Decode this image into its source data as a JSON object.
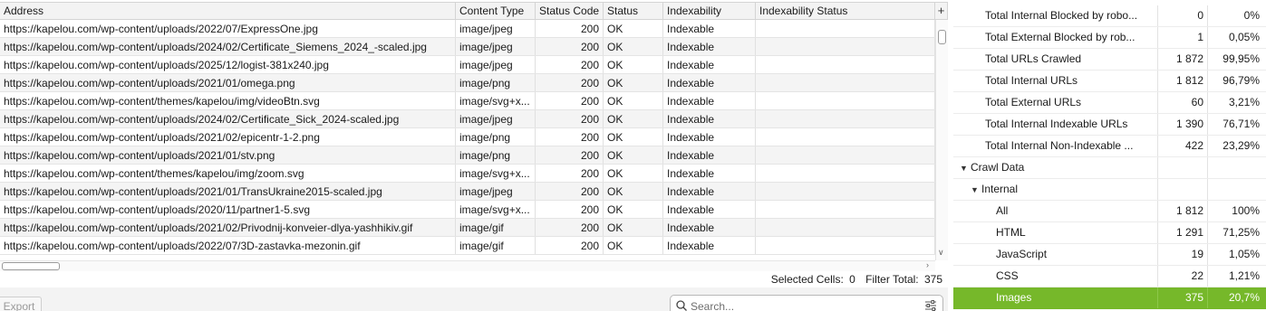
{
  "table": {
    "columns": [
      "Address",
      "Content Type",
      "Status Code",
      "Status",
      "Indexability",
      "Indexability Status"
    ],
    "rows": [
      {
        "address": "https://kapelou.com/wp-content/uploads/2022/07/ExpressOne.jpg",
        "content_type": "image/jpeg",
        "status_code": "200",
        "status": "OK",
        "indexability": "Indexable",
        "indexability_status": ""
      },
      {
        "address": "https://kapelou.com/wp-content/uploads/2024/02/Certificate_Siemens_2024_-scaled.jpg",
        "content_type": "image/jpeg",
        "status_code": "200",
        "status": "OK",
        "indexability": "Indexable",
        "indexability_status": ""
      },
      {
        "address": "https://kapelou.com/wp-content/uploads/2025/12/logist-381x240.jpg",
        "content_type": "image/jpeg",
        "status_code": "200",
        "status": "OK",
        "indexability": "Indexable",
        "indexability_status": ""
      },
      {
        "address": "https://kapelou.com/wp-content/uploads/2021/01/omega.png",
        "content_type": "image/png",
        "status_code": "200",
        "status": "OK",
        "indexability": "Indexable",
        "indexability_status": ""
      },
      {
        "address": "https://kapelou.com/wp-content/themes/kapelou/img/videoBtn.svg",
        "content_type": "image/svg+x...",
        "status_code": "200",
        "status": "OK",
        "indexability": "Indexable",
        "indexability_status": ""
      },
      {
        "address": "https://kapelou.com/wp-content/uploads/2024/02/Certificate_Sick_2024-scaled.jpg",
        "content_type": "image/jpeg",
        "status_code": "200",
        "status": "OK",
        "indexability": "Indexable",
        "indexability_status": ""
      },
      {
        "address": "https://kapelou.com/wp-content/uploads/2021/02/epicentr-1-2.png",
        "content_type": "image/png",
        "status_code": "200",
        "status": "OK",
        "indexability": "Indexable",
        "indexability_status": ""
      },
      {
        "address": "https://kapelou.com/wp-content/uploads/2021/01/stv.png",
        "content_type": "image/png",
        "status_code": "200",
        "status": "OK",
        "indexability": "Indexable",
        "indexability_status": ""
      },
      {
        "address": "https://kapelou.com/wp-content/themes/kapelou/img/zoom.svg",
        "content_type": "image/svg+x...",
        "status_code": "200",
        "status": "OK",
        "indexability": "Indexable",
        "indexability_status": ""
      },
      {
        "address": "https://kapelou.com/wp-content/uploads/2021/01/TransUkraine2015-scaled.jpg",
        "content_type": "image/jpeg",
        "status_code": "200",
        "status": "OK",
        "indexability": "Indexable",
        "indexability_status": ""
      },
      {
        "address": "https://kapelou.com/wp-content/uploads/2020/11/partner1-5.svg",
        "content_type": "image/svg+x...",
        "status_code": "200",
        "status": "OK",
        "indexability": "Indexable",
        "indexability_status": ""
      },
      {
        "address": "https://kapelou.com/wp-content/uploads/2021/02/Privodnij-konveier-dlya-yashhikiv.gif",
        "content_type": "image/gif",
        "status_code": "200",
        "status": "OK",
        "indexability": "Indexable",
        "indexability_status": ""
      },
      {
        "address": "https://kapelou.com/wp-content/uploads/2022/07/3D-zastavka-mezonin.gif",
        "content_type": "image/gif",
        "status_code": "200",
        "status": "OK",
        "indexability": "Indexable",
        "indexability_status": ""
      }
    ],
    "add_column_label": "+"
  },
  "status_bar": {
    "selected_label": "Selected Cells:",
    "selected_value": "0",
    "filter_label": "Filter Total:",
    "filter_value": "375"
  },
  "footer": {
    "export_label": "Export",
    "search_placeholder": "Search..."
  },
  "overview": {
    "rows": [
      {
        "label": "Total Internal Blocked by robo...",
        "count": "0",
        "pct": "0%",
        "depth": 0,
        "expander": "",
        "selected": false
      },
      {
        "label": "Total External Blocked by rob...",
        "count": "1",
        "pct": "0,05%",
        "depth": 0,
        "expander": "",
        "selected": false
      },
      {
        "label": "Total URLs Crawled",
        "count": "1 872",
        "pct": "99,95%",
        "depth": 0,
        "expander": "",
        "selected": false
      },
      {
        "label": "Total Internal URLs",
        "count": "1 812",
        "pct": "96,79%",
        "depth": 0,
        "expander": "",
        "selected": false
      },
      {
        "label": "Total External URLs",
        "count": "60",
        "pct": "3,21%",
        "depth": 0,
        "expander": "",
        "selected": false
      },
      {
        "label": "Total Internal Indexable URLs",
        "count": "1 390",
        "pct": "76,71%",
        "depth": 0,
        "expander": "",
        "selected": false
      },
      {
        "label": "Total Internal Non-Indexable ...",
        "count": "422",
        "pct": "23,29%",
        "depth": 0,
        "expander": "",
        "selected": false
      },
      {
        "label": "Crawl Data",
        "count": "",
        "pct": "",
        "depth": 0,
        "expander": "expanded",
        "selected": false
      },
      {
        "label": "Internal",
        "count": "",
        "pct": "",
        "depth": 1,
        "expander": "expanded",
        "selected": false
      },
      {
        "label": "All",
        "count": "1 812",
        "pct": "100%",
        "depth": 2,
        "expander": "",
        "selected": false
      },
      {
        "label": "HTML",
        "count": "1 291",
        "pct": "71,25%",
        "depth": 2,
        "expander": "",
        "selected": false
      },
      {
        "label": "JavaScript",
        "count": "19",
        "pct": "1,05%",
        "depth": 2,
        "expander": "",
        "selected": false
      },
      {
        "label": "CSS",
        "count": "22",
        "pct": "1,21%",
        "depth": 2,
        "expander": "",
        "selected": false
      },
      {
        "label": "Images",
        "count": "375",
        "pct": "20,7%",
        "depth": 2,
        "expander": "",
        "selected": true
      }
    ]
  },
  "colors": {
    "selected_row": "#76b82a",
    "header_bg": "#f3f3f3",
    "alt_row_bg": "#f4f4f4"
  }
}
